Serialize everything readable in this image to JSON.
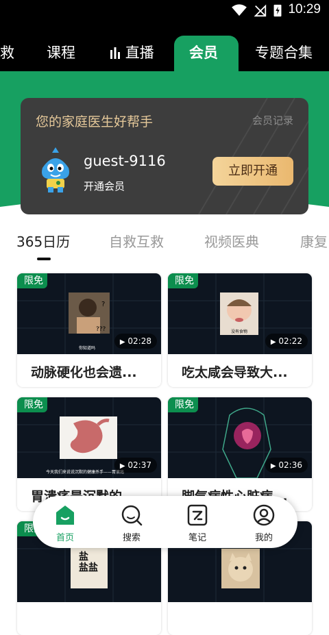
{
  "status_bar": {
    "time": "10:29"
  },
  "top_tabs": [
    "救",
    "课程",
    "直播",
    "会员",
    "专题合集"
  ],
  "member_card": {
    "slogan": "您的家庭医生好帮手",
    "record_link": "会员记录",
    "username": "guest-9116",
    "subtitle": "开通会员",
    "open_button": "立即开通"
  },
  "categories": [
    "365日历",
    "自救互救",
    "视频医典",
    "康复"
  ],
  "videos": [
    {
      "badge": "限免",
      "duration": "02:28",
      "title": "动脉硬化也会遗...",
      "caption": "你知道吗"
    },
    {
      "badge": "限免",
      "duration": "02:22",
      "title": "吃太咸会导致大...",
      "caption": "没有食物"
    },
    {
      "badge": "限免",
      "duration": "02:37",
      "title": "胃溃疡是沉默的...",
      "caption": "今天我们来说说沉默的健康杀手——胃溃疡"
    },
    {
      "badge": "限免",
      "duration": "02:36",
      "title": "脚气病性心脏病...",
      "caption": ""
    },
    {
      "badge": "限免",
      "duration": "",
      "title": "",
      "caption": "盐\n盐盐"
    },
    {
      "badge": "",
      "duration": "",
      "title": "",
      "caption": ""
    }
  ],
  "bottom_nav": [
    {
      "label": "首页",
      "icon": "home-icon",
      "active": true
    },
    {
      "label": "搜索",
      "icon": "search-icon",
      "active": false
    },
    {
      "label": "笔记",
      "icon": "notes-icon",
      "active": false
    },
    {
      "label": "我的",
      "icon": "profile-icon",
      "active": false
    }
  ],
  "colors": {
    "brand_green": "#17a061",
    "card_dark": "#3d3d3d",
    "gold": "#e6c99a"
  }
}
